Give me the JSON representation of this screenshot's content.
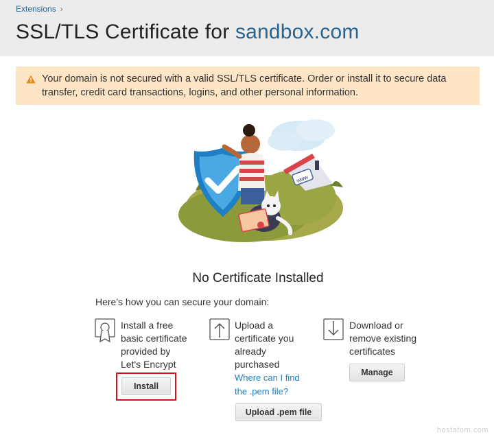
{
  "breadcrumb": {
    "label": "Extensions"
  },
  "header": {
    "title_prefix": "SSL/TLS Certificate for",
    "domain": "sandbox.com"
  },
  "alert": {
    "text": "Your domain is not secured with a valid SSL/TLS certificate. Order or install it to secure data transfer, credit card transactions, logins, and other personal information.",
    "icon": "warning-icon",
    "color": "#e8891a"
  },
  "illustration": {
    "sign_text": "www"
  },
  "empty_state": {
    "title": "No Certificate Installed",
    "subtitle": "Here's how you can secure your domain:"
  },
  "options": {
    "install": {
      "icon": "certificate-badge-icon",
      "lines": [
        "Install a free",
        "basic certificate",
        "provided by",
        "Let's Encrypt"
      ],
      "button": "Install"
    },
    "upload": {
      "icon": "upload-icon",
      "lines": [
        "Upload a",
        "certificate you",
        "already",
        "purchased"
      ],
      "link_lines": [
        "Where can I find",
        "the .pem file?"
      ],
      "button": "Upload .pem file"
    },
    "manage": {
      "icon": "download-icon",
      "lines": [
        "Download or",
        "remove existing",
        "certificates"
      ],
      "button": "Manage"
    }
  },
  "watermark": "hostatom.com",
  "colors": {
    "link": "#28648e",
    "alert_bg": "#fde5c5",
    "highlight": "#d5101b"
  }
}
